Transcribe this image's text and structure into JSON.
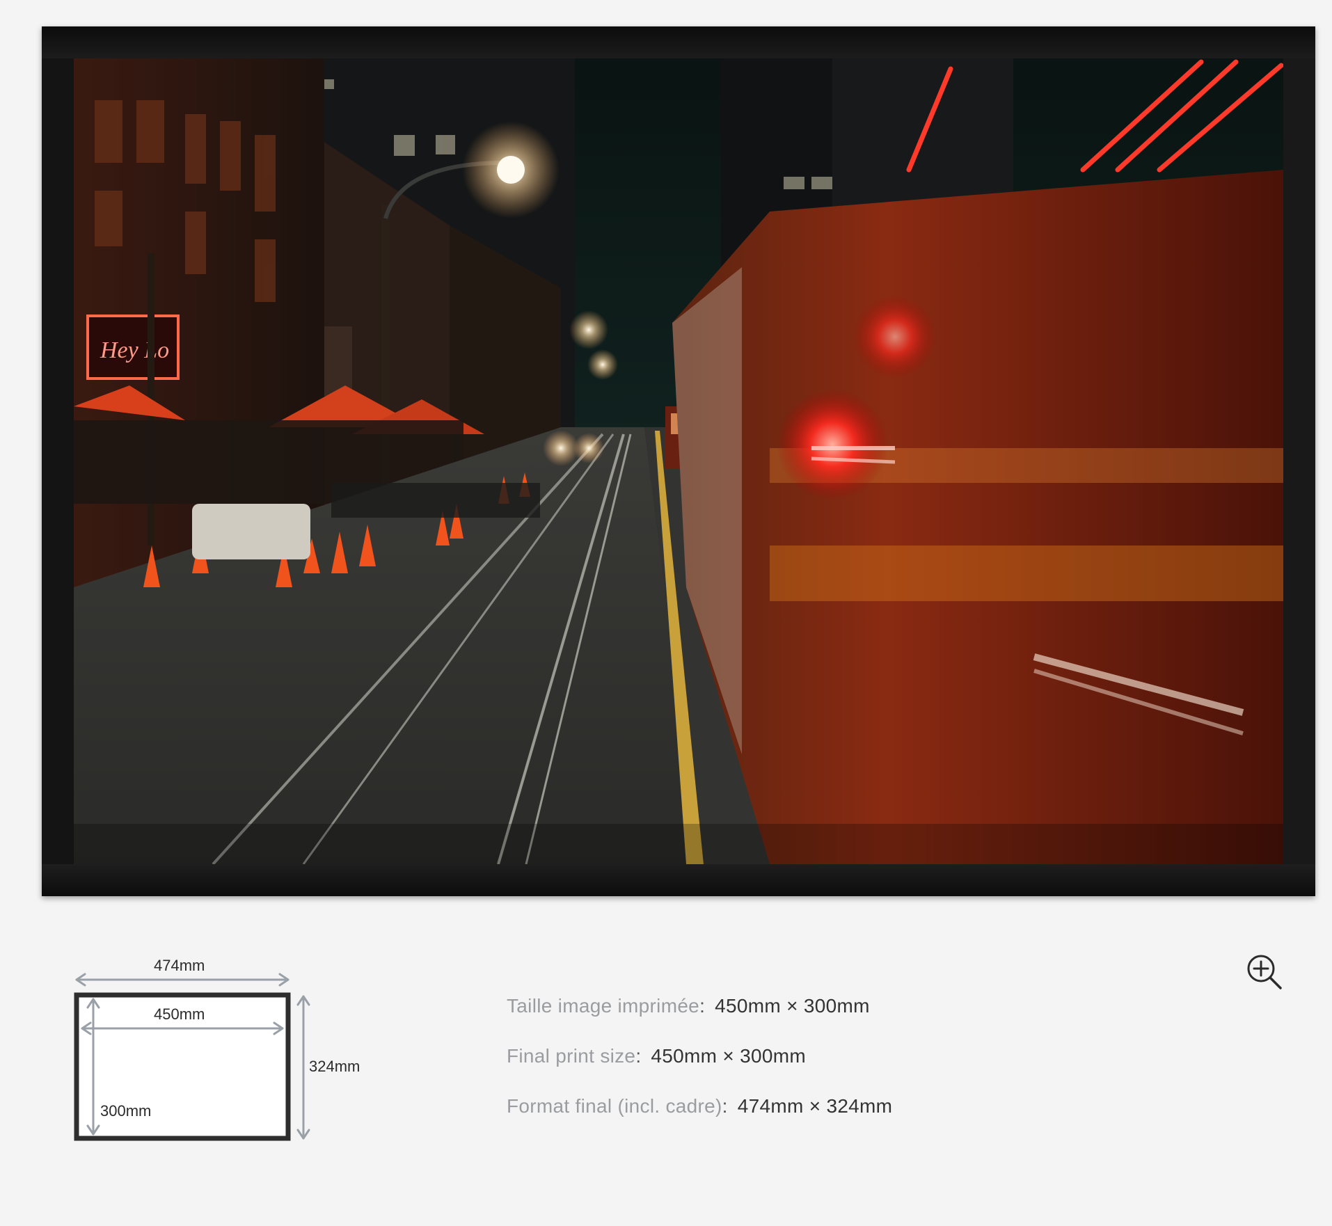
{
  "photo": {
    "description_icon": "photo-image",
    "neon_sign_text": "Hey Lo"
  },
  "diagram": {
    "outer_width_label": "474mm",
    "inner_width_label": "450mm",
    "outer_height_label": "324mm",
    "inner_height_label": "300mm"
  },
  "specs": [
    {
      "label": "Taille image imprimée",
      "value": "450mm × 300mm"
    },
    {
      "label": "Final print size",
      "value": "450mm × 300mm"
    },
    {
      "label": "Format final (incl. cadre)",
      "value": "474mm × 324mm"
    }
  ],
  "zoom": {
    "icon": "zoom-in-icon"
  },
  "colors": {
    "page_bg": "#f4f4f4",
    "frame": "#141414",
    "label_grey": "#9a9ca0",
    "value_dark": "#333333",
    "arrow_grey": "#9aa0a8"
  }
}
